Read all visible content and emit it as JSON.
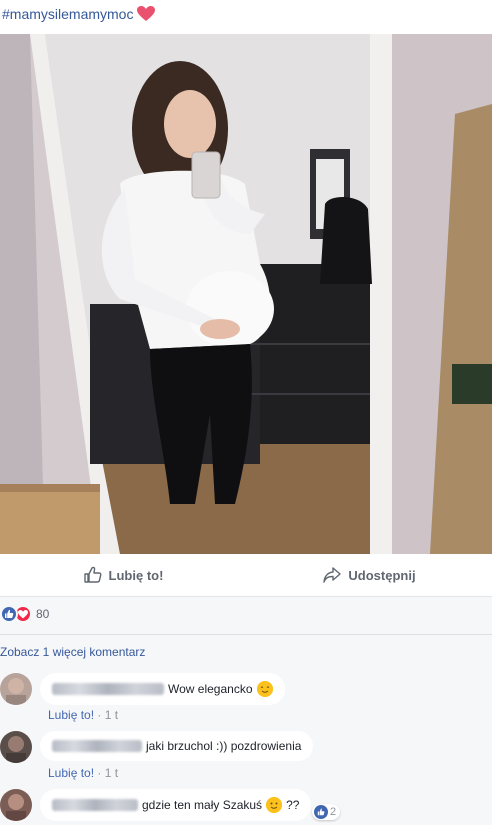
{
  "post": {
    "hashtag": "#mamysilemamymoc",
    "heart_color": "#e9516e"
  },
  "actions": {
    "like_label": "Lubię to!",
    "share_label": "Udostępnij"
  },
  "reactions": {
    "count": "80"
  },
  "comments": {
    "more_label": "Zobacz 1 więcej komentarz",
    "items": [
      {
        "text": "Wow elegancko",
        "emoji": "smiling-face-emoji",
        "like_label": "Lubię to!",
        "sep": " · ",
        "time": "1 t"
      },
      {
        "text": "jaki brzuchol :)) pozdrowienia",
        "like_label": "Lubię to!",
        "sep": " · ",
        "time": "1 t"
      },
      {
        "text": "gdzie ten mały Szakuś",
        "emoji": "smiling-face-emoji",
        "suffix": "??",
        "like_count": "2"
      }
    ]
  },
  "colors": {
    "link": "#365899",
    "like_blue": "#4267b2",
    "love_red": "#f0284a",
    "muted": "#90949c"
  }
}
